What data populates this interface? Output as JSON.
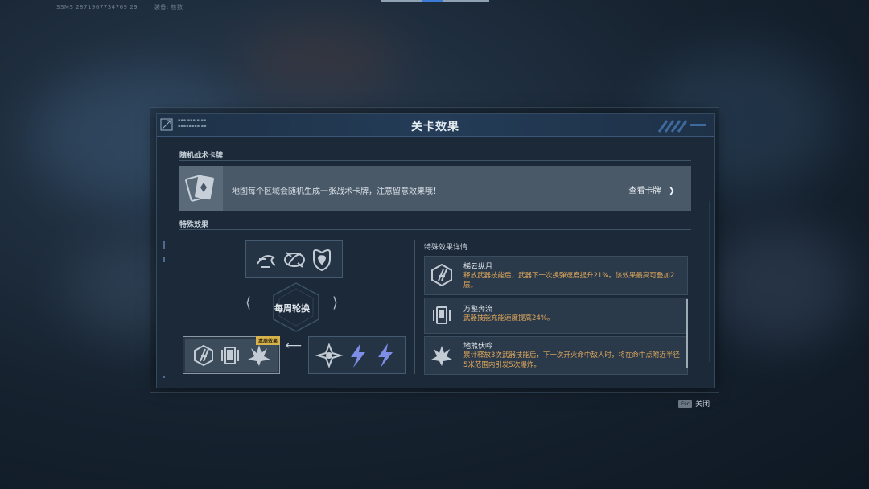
{
  "top_info": {
    "uid": "SSMS 2871967734769 29",
    "label": "装备: 核数"
  },
  "dialog": {
    "title": "关卡效果"
  },
  "random_cards": {
    "section_title": "随机战术卡牌",
    "description": "地图每个区域会随机生成一张战术卡牌，注意留意效果哦！",
    "link_label": "查看卡牌",
    "icon": "cards-icon"
  },
  "special_effects": {
    "section_title": "特殊效果",
    "rotation_label": "每周轮换",
    "this_week_badge": "本周效果",
    "groups": [
      {
        "icons": [
          "dragon-icon",
          "chain-icon",
          "heart-shield-icon"
        ]
      },
      {
        "icons": [
          "ladder-icon",
          "phone-burst-icon",
          "explosion-icon"
        ],
        "this_week": true
      },
      {
        "icons": [
          "shuriken-icon",
          "lightning-icon",
          "lightning-icon"
        ]
      }
    ]
  },
  "details": {
    "title": "特殊效果详情",
    "items": [
      {
        "name": "梯云纵月",
        "desc": "释放武器技能后，武器下一次换弹速度提升21%。该效果最高可叠加2层。",
        "icon": "ladder-icon"
      },
      {
        "name": "万壑奔流",
        "desc": "武器技能充能速度提高24%。",
        "icon": "phone-burst-icon"
      },
      {
        "name": "地煞伏吟",
        "desc": "累计释放3次武器技能后，下一次开火命中敌人时，将在命中点附近半径5米范围内引发5次爆炸。",
        "icon": "explosion-icon"
      }
    ]
  },
  "footer": {
    "esc_key": "Esc",
    "close_label": "关闭"
  },
  "colors": {
    "accent_gold": "#d8b24a",
    "detail_text": "#e0a85c",
    "lightning": "#7e8de6",
    "header_blue": "#243c57"
  }
}
